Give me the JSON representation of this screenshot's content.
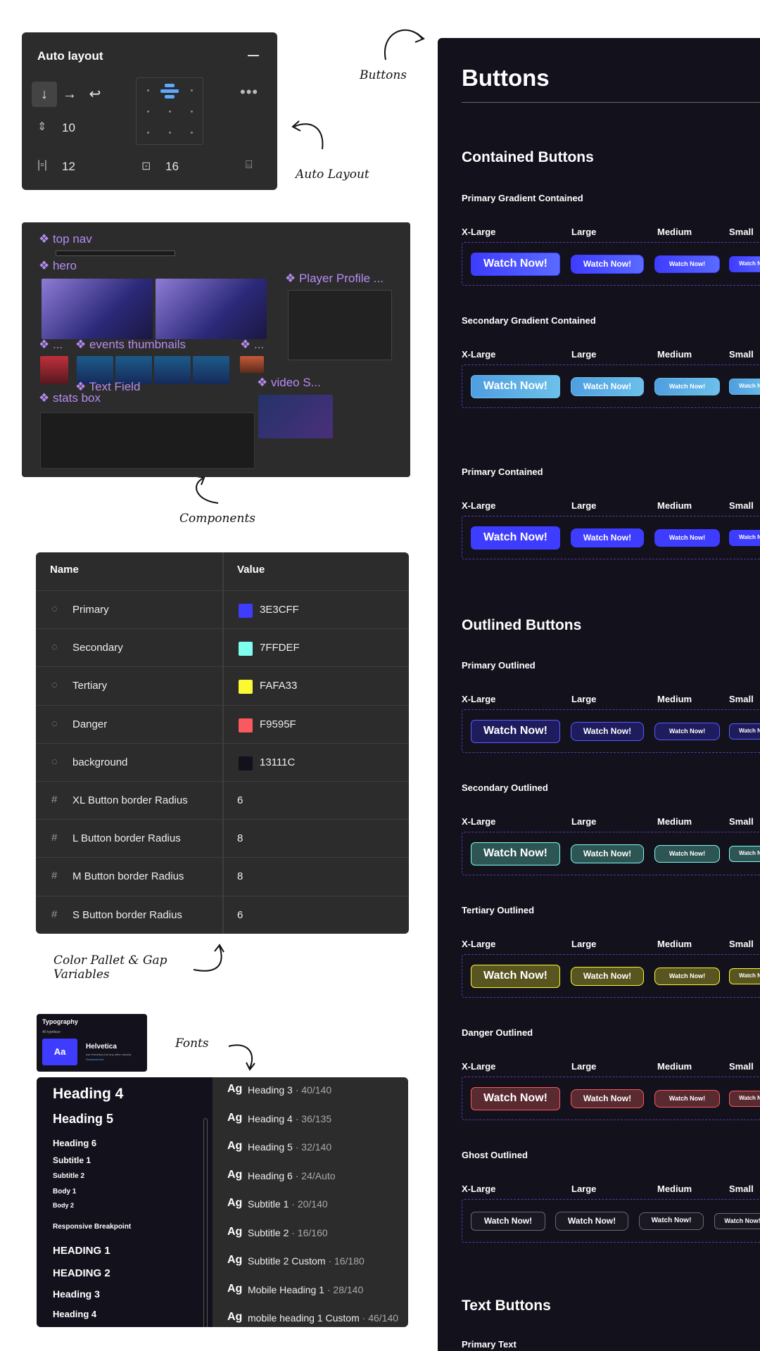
{
  "annotations": {
    "buttons": "Buttons",
    "auto_layout": "Auto Layout",
    "components": "Components",
    "color_pallet": "Color Pallet & Gap\nVariables",
    "fonts": "Fonts"
  },
  "auto_layout": {
    "title": "Auto layout",
    "gap": "10",
    "padding_h": "12",
    "padding_v": "16"
  },
  "components": {
    "labels": {
      "top_nav": "❖ top nav",
      "hero": "❖ hero",
      "player_profile": "❖ Player Profile ...",
      "events_prefix": "❖ ...",
      "events_thumbnails": "❖ events thumbnails",
      "events_suffix": "❖ ...",
      "text_field": "❖ Text Field",
      "video": "❖ video S...",
      "stats_box": "❖ stats box"
    }
  },
  "variables": {
    "headers": {
      "name": "Name",
      "value": "Value"
    },
    "rows": [
      {
        "name": "Primary",
        "value": "3E3CFF",
        "color": "#3E3CFF",
        "type": "color"
      },
      {
        "name": "Secondary",
        "value": "7FFDEF",
        "color": "#7FFDEF",
        "type": "color"
      },
      {
        "name": "Tertiary",
        "value": "FAFA33",
        "color": "#FAFA33",
        "type": "color"
      },
      {
        "name": "Danger",
        "value": "F9595F",
        "color": "#F9595F",
        "type": "color"
      },
      {
        "name": "background",
        "value": "13111C",
        "color": "#13111C",
        "type": "color"
      },
      {
        "name": "XL Button border Radius",
        "value": "6",
        "type": "number"
      },
      {
        "name": "L Button border Radius",
        "value": "8",
        "type": "number"
      },
      {
        "name": "M Button border Radius",
        "value": "8",
        "type": "number"
      },
      {
        "name": "S Button border Radius",
        "value": "6",
        "type": "number"
      }
    ]
  },
  "typography_card": {
    "title": "Typography",
    "subtitle": "All typeface",
    "sample": "Aa",
    "font_name": "Helvetica",
    "font_desc": "use Helvetica (not any other variant)",
    "link": "Download font"
  },
  "typography_left": [
    "Heading 4",
    "Heading 5",
    "Heading 6",
    "Subtitle 1",
    "Subtitle 2",
    "Body 1",
    "Body 2",
    "Responsive Breakpoint",
    "HEADING 1",
    "HEADING 2",
    "Heading 3",
    "Heading 4"
  ],
  "typography_styles": [
    {
      "name": "Heading 3",
      "meta": "40/140"
    },
    {
      "name": "Heading 4",
      "meta": "36/135"
    },
    {
      "name": "Heading 5",
      "meta": "32/140"
    },
    {
      "name": "Heading 6",
      "meta": "24/Auto"
    },
    {
      "name": "Subtitle 1",
      "meta": "20/140"
    },
    {
      "name": "Subtitle 2",
      "meta": "16/160"
    },
    {
      "name": "Subtitle 2 Custom",
      "meta": "16/180"
    },
    {
      "name": "Mobile Heading 1",
      "meta": "28/140"
    },
    {
      "name": "mobile heading 1 Custom",
      "meta": "46/140"
    }
  ],
  "ag": "Ag",
  "board": {
    "title": "Buttons",
    "sections": {
      "contained": "Contained Buttons",
      "outlined": "Outlined Buttons",
      "text": "Text Buttons"
    },
    "sizes": [
      "X-Large",
      "Large",
      "Medium",
      "Small"
    ],
    "button_label": "Watch Now!",
    "small_label": "Watch N",
    "groups": [
      {
        "label": "Primary Gradient Contained",
        "variant": "contained",
        "fill": "#3E3CFF",
        "fill2": "#5a6bff",
        "border": "#3E3CFF",
        "text": "#ffffff"
      },
      {
        "label": "Secondary Gradient Contained",
        "variant": "contained",
        "fill": "#4f9ee0",
        "fill2": "#6cc0ea",
        "border": "#6cc0ea",
        "text": "#ffffff"
      },
      {
        "label": "Primary Contained",
        "variant": "contained",
        "fill": "#3E3CFF",
        "fill2": "#3E3CFF",
        "border": "#3E3CFF",
        "text": "#ffffff"
      },
      {
        "label": "Primary Outlined",
        "variant": "outlined",
        "fill": "#1e1c5c",
        "border": "#5b5aff",
        "text": "#ffffff"
      },
      {
        "label": "Secondary Outlined",
        "variant": "outlined",
        "fill": "#2d5553",
        "border": "#7FFDEF",
        "text": "#ffffff"
      },
      {
        "label": "Tertiary Outlined",
        "variant": "outlined",
        "fill": "#595520",
        "border": "#FAFA33",
        "text": "#ffffff"
      },
      {
        "label": "Danger Outlined",
        "variant": "outlined",
        "fill": "#5a2a31",
        "border": "#F9595F",
        "text": "#ffffff"
      },
      {
        "label": "Ghost Outlined",
        "variant": "ghost",
        "fill": "#1a1822",
        "border": "#6a6a6a",
        "text": "#ffffff"
      }
    ],
    "last_label": "Primary Text"
  }
}
